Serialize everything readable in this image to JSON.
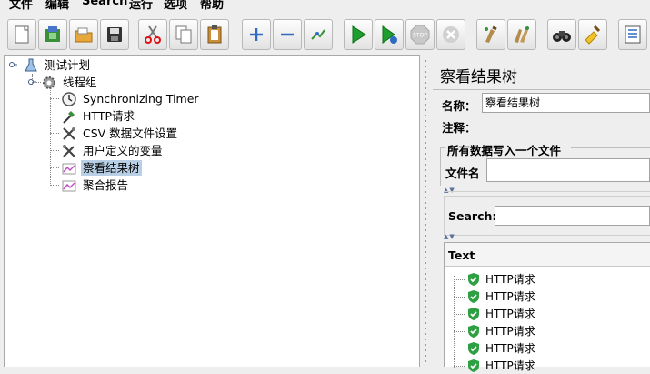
{
  "menu": {
    "items": [
      "文件",
      "编辑",
      "Search",
      "运行",
      "选项",
      "帮助"
    ]
  },
  "toolbar": {
    "buttons": [
      {
        "name": "new-icon"
      },
      {
        "name": "templates-icon"
      },
      {
        "name": "open-icon"
      },
      {
        "name": "save-icon"
      },
      {
        "name": "cut-icon"
      },
      {
        "name": "copy-icon"
      },
      {
        "name": "paste-icon"
      },
      {
        "name": "expand-icon"
      },
      {
        "name": "collapse-icon"
      },
      {
        "name": "toggle-icon"
      },
      {
        "name": "start-icon"
      },
      {
        "name": "start-no-pauses-icon"
      },
      {
        "name": "stop-icon"
      },
      {
        "name": "shutdown-icon"
      },
      {
        "name": "clear-icon"
      },
      {
        "name": "clear-all-icon"
      },
      {
        "name": "search-binoculars-icon"
      },
      {
        "name": "reset-search-icon"
      },
      {
        "name": "function-helper-icon"
      }
    ],
    "stop_text": "STOP"
  },
  "tree": {
    "root": "测试计划",
    "thread_group": "线程组",
    "children": [
      {
        "label": "Synchronizing Timer",
        "icon": "timer-icon"
      },
      {
        "label": "HTTP请求",
        "icon": "http-sampler-icon"
      },
      {
        "label": "CSV 数据文件设置",
        "icon": "csv-config-icon"
      },
      {
        "label": "用户定义的变量",
        "icon": "variables-icon"
      },
      {
        "label": "察看结果树",
        "icon": "listener-icon",
        "selected": true
      },
      {
        "label": "聚合报告",
        "icon": "listener-icon"
      }
    ]
  },
  "right": {
    "title": "察看结果树",
    "name_label": "名称：",
    "name_value": "察看结果树",
    "comment_label": "注释：",
    "comment_value": "",
    "file_section_title": "所有数据写入一个文件",
    "filename_label": "文件名",
    "filename_value": "",
    "search_label": "Search:",
    "search_value": "",
    "results_header": "Text",
    "results": [
      "HTTP请求",
      "HTTP请求",
      "HTTP请求",
      "HTTP请求",
      "HTTP请求",
      "HTTP请求"
    ]
  },
  "colors": {
    "selection": "#b8cfe5",
    "success_shield": "#2ea043",
    "play_green": "#1e9e2e"
  }
}
